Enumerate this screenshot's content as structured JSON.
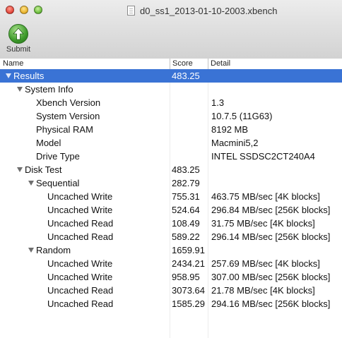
{
  "window": {
    "title": "d0_ss1_2013-01-10-2003.xbench"
  },
  "toolbar": {
    "submit_label": "Submit"
  },
  "columns": {
    "name": "Name",
    "score": "Score",
    "detail": "Detail"
  },
  "rows": [
    {
      "name": "Results",
      "score": "483.25",
      "detail": "",
      "level": 0,
      "expander": true,
      "selected": true
    },
    {
      "name": "System Info",
      "score": "",
      "detail": "",
      "level": 1,
      "expander": true
    },
    {
      "name": "Xbench Version",
      "score": "",
      "detail": "1.3",
      "level": 2
    },
    {
      "name": "System Version",
      "score": "",
      "detail": "10.7.5 (11G63)",
      "level": 2
    },
    {
      "name": "Physical RAM",
      "score": "",
      "detail": "8192 MB",
      "level": 2
    },
    {
      "name": "Model",
      "score": "",
      "detail": "Macmini5,2",
      "level": 2
    },
    {
      "name": "Drive Type",
      "score": "",
      "detail": "INTEL SSDSC2CT240A4",
      "level": 2
    },
    {
      "name": "Disk Test",
      "score": "483.25",
      "detail": "",
      "level": 1,
      "expander": true
    },
    {
      "name": "Sequential",
      "score": "282.79",
      "detail": "",
      "level": 2,
      "expander": true
    },
    {
      "name": "Uncached Write",
      "score": "755.31",
      "detail": "463.75 MB/sec [4K blocks]",
      "level": 3
    },
    {
      "name": "Uncached Write",
      "score": "524.64",
      "detail": "296.84 MB/sec [256K blocks]",
      "level": 3
    },
    {
      "name": "Uncached Read",
      "score": "108.49",
      "detail": "31.75 MB/sec [4K blocks]",
      "level": 3
    },
    {
      "name": "Uncached Read",
      "score": "589.22",
      "detail": "296.14 MB/sec [256K blocks]",
      "level": 3
    },
    {
      "name": "Random",
      "score": "1659.91",
      "detail": "",
      "level": 2,
      "expander": true
    },
    {
      "name": "Uncached Write",
      "score": "2434.21",
      "detail": "257.69 MB/sec [4K blocks]",
      "level": 3
    },
    {
      "name": "Uncached Write",
      "score": "958.95",
      "detail": "307.00 MB/sec [256K blocks]",
      "level": 3
    },
    {
      "name": "Uncached Read",
      "score": "3073.64",
      "detail": "21.78 MB/sec [4K blocks]",
      "level": 3
    },
    {
      "name": "Uncached Read",
      "score": "1585.29",
      "detail": "294.16 MB/sec [256K blocks]",
      "level": 3
    }
  ]
}
